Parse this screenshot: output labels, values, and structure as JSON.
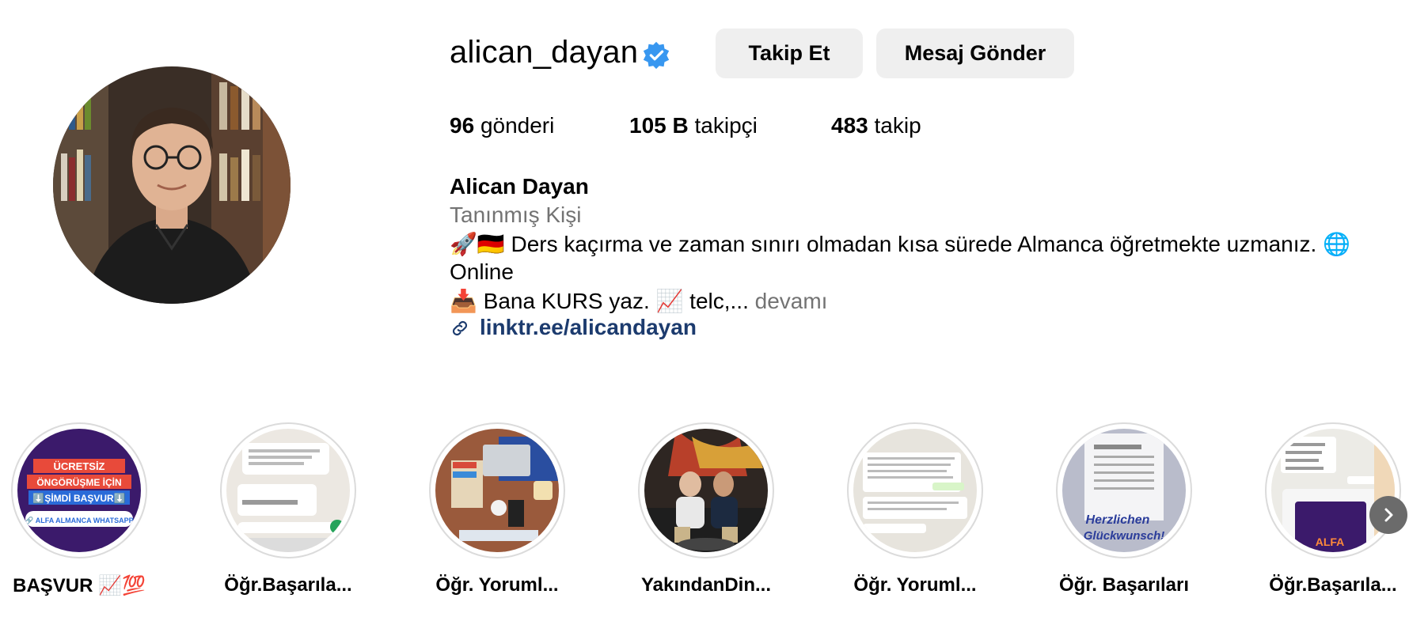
{
  "profile": {
    "username": "alican_dayan",
    "follow_label": "Takip Et",
    "message_label": "Mesaj Gönder",
    "stats": {
      "posts_count": "96",
      "posts_label": "gönderi",
      "followers_count": "105 B",
      "followers_label": "takipçi",
      "following_count": "483",
      "following_label": "takip"
    },
    "full_name": "Alican Dayan",
    "category": "Tanınmış Kişi",
    "bio": {
      "line1": "🚀🇩🇪 Ders kaçırma ve zaman sınırı olmadan kısa sürede Almanca öğretmekte uzmanız. 🌐",
      "line2": "Online",
      "line3": "📥 Bana KURS yaz. 📈 telc,...",
      "more": "devamı"
    },
    "link": "linktr.ee/alicandayan"
  },
  "highlights": [
    {
      "label": "BAŞVUR 📈💯"
    },
    {
      "label": "Öğr.Başarıla..."
    },
    {
      "label": "Öğr. Yoruml..."
    },
    {
      "label": "YakındanDin..."
    },
    {
      "label": "Öğr. Yoruml..."
    },
    {
      "label": "Öğr. Başarıları"
    },
    {
      "label": "Öğr.Başarıla..."
    }
  ],
  "highlight_overlay_text": {
    "h1_line1": "ÜCRETSİZ",
    "h1_line2": "ÖNGÖRÜŞME İÇİN",
    "h1_line3": "⬇️ŞİMDİ BAŞVUR⬇️",
    "h1_button": "🔗 ALFA ALMANCA WHATSAPP",
    "h6_text1": "Herzlichen",
    "h6_text2": "Glückwunsch!",
    "h7_text": "ALFA"
  },
  "colors": {
    "verified": "#3897f0",
    "link": "#1c3b6e",
    "muted": "#737373",
    "button_bg": "#efefef"
  }
}
